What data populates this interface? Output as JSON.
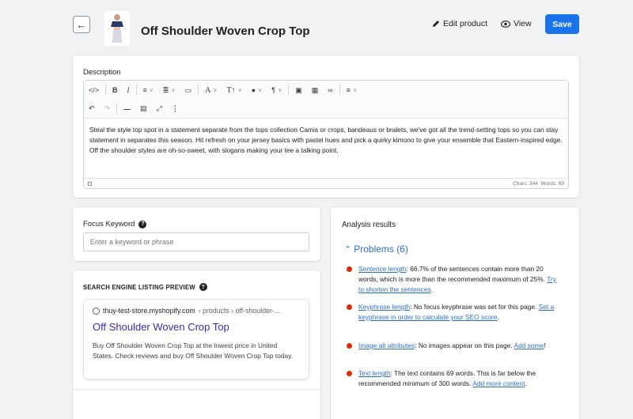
{
  "header": {
    "title": "Off Shoulder Woven Crop Top",
    "edit_label": "Edit product",
    "view_label": "View",
    "save_label": "Save",
    "back_icon": "arrow-left-icon",
    "accent": "#1a73e8"
  },
  "description": {
    "label": "Description",
    "text": "Steal the style top spot in a statement separate from the tops collection Camis or crops, bandeaus or bralets, we've got all the trend-setting tops so you can stay statement in separates this season. Hit refresh on your jersey basics with pastel hues and pick a quirky kimono to give your ensemble that Eastern-inspired edge. Off the shoulder styles are oh-so-sweet, with slogans making your tee a talking point.",
    "chars": "Chars: 344",
    "words": "Words: 69"
  },
  "focus": {
    "label": "Focus Keyword",
    "placeholder": "Enter a keyword or phrase"
  },
  "seo": {
    "label": "SEARCH ENGINE LISTING PREVIEW",
    "url_domain": "thuy-test-store.myshopify.com",
    "url_path": " › products › off-shoulder-...",
    "title": "Off Shoulder Woven Crop Top",
    "description": "Buy Off Shoulder Woven Crop Top at the lowest price in United States. Check reviews and buy Off Shoulder Woven Crop Top today."
  },
  "analysis": {
    "title": "Analysis results",
    "problems_label": "Problems (6)",
    "status_color": "#d82c0d",
    "issues": [
      {
        "name": "Sentence length",
        "text": ": 66.7% of the sentences contain more than 20 words, which is more than the recommended maximum of 25%. ",
        "action": "Try to shorten the sentences",
        "end": "."
      },
      {
        "name": "Keyphrase length",
        "text": ": No focus keyphrase was set for this page. ",
        "action": "Set a keyphrase in order to calculate your SEO score",
        "end": "."
      },
      {
        "name": "Image alt attributes",
        "text": ": No images appear on this page. ",
        "action": "Add some",
        "end": "!"
      },
      {
        "name": "Text length",
        "text": ": The text contains 69 words. This is far below the recommended minimum of 300 words. ",
        "action": "Add more content",
        "end": "."
      }
    ]
  }
}
